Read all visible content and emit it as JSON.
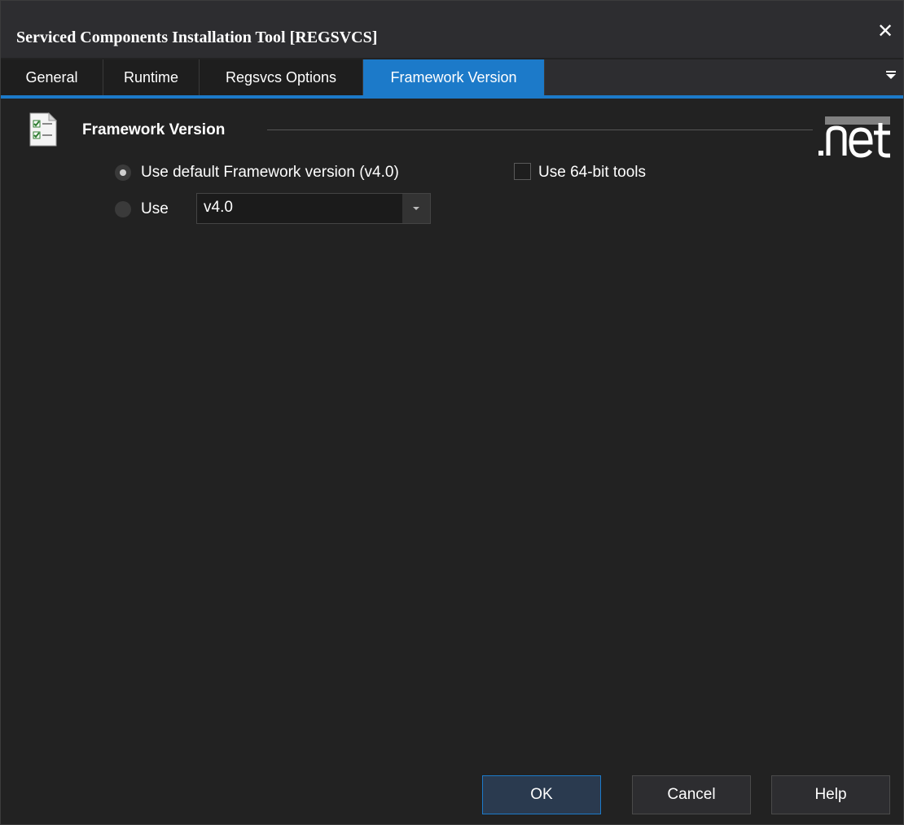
{
  "window": {
    "title": "Serviced Components Installation Tool  [REGSVCS]",
    "close_glyph": "✕"
  },
  "tabs": [
    {
      "label": "General",
      "active": false
    },
    {
      "label": "Runtime",
      "active": false
    },
    {
      "label": "Regsvcs Options",
      "active": false
    },
    {
      "label": "Framework Version",
      "active": true
    }
  ],
  "section": {
    "title": "Framework Version",
    "icon": "checklist-document-icon",
    "logo": "dotnet-logo"
  },
  "options": {
    "default_label": "Use default Framework version (v4.0)",
    "default_selected": true,
    "use_label": "Use",
    "use_selected": false,
    "version_value": "v4.0",
    "use64_label": "Use 64-bit tools",
    "use64_checked": false
  },
  "buttons": {
    "ok": "OK",
    "cancel": "Cancel",
    "help": "Help"
  },
  "colors": {
    "accent": "#1c7ac9",
    "background": "#222222"
  }
}
